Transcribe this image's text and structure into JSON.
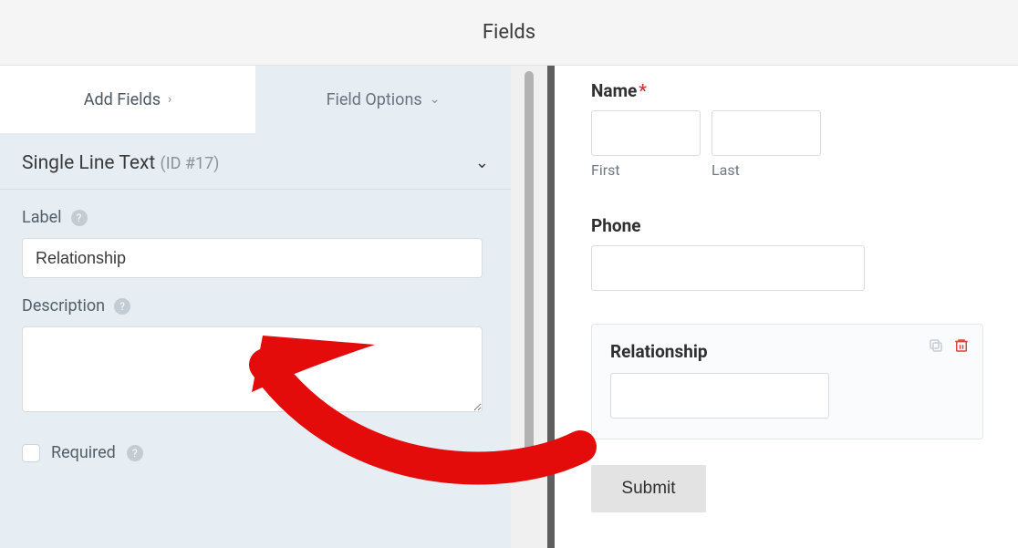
{
  "header": {
    "title": "Fields"
  },
  "tabs": {
    "add": "Add Fields",
    "options": "Field Options"
  },
  "fieldHeader": {
    "type": "Single Line Text",
    "id": "(ID #17)"
  },
  "options": {
    "labelLabel": "Label",
    "labelValue": "Relationship",
    "descriptionLabel": "Description",
    "descriptionValue": "",
    "requiredLabel": "Required"
  },
  "preview": {
    "name": {
      "label": "Name",
      "first": "First",
      "last": "Last"
    },
    "phone": {
      "label": "Phone"
    },
    "relationship": {
      "label": "Relationship"
    },
    "submit": "Submit"
  },
  "glyphs": {
    "chevronRight": "›",
    "chevronDown": "⌄",
    "help": "?",
    "requiredStar": "*"
  }
}
